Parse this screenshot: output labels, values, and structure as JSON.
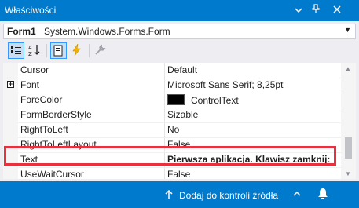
{
  "window": {
    "title": "Właściwości"
  },
  "selector": {
    "object_name": "Form1",
    "object_type": "System.Windows.Forms.Form"
  },
  "toolbar": {
    "icons": [
      "categorized-icon",
      "alphabetical-icon",
      "properties-icon",
      "events-icon",
      "wrench-icon"
    ]
  },
  "properties": [
    {
      "name": "Cursor",
      "value": "Default",
      "expandable": false
    },
    {
      "name": "Font",
      "value": "Microsoft Sans Serif; 8,25pt",
      "expandable": true,
      "expander": "+"
    },
    {
      "name": "ForeColor",
      "value": "ControlText",
      "swatch": "#000000"
    },
    {
      "name": "FormBorderStyle",
      "value": "Sizable"
    },
    {
      "name": "RightToLeft",
      "value": "No"
    },
    {
      "name": "RightToLeftLayout",
      "value": "False"
    },
    {
      "name": "Text",
      "value": "Pierwsza aplikacja. Klawisz zamknij:",
      "bold": true
    },
    {
      "name": "UseWaitCursor",
      "value": "False"
    }
  ],
  "statusbar": {
    "source_control": "Dodaj do kontroli źródła"
  },
  "colors": {
    "accent": "#007acc",
    "highlight": "#e8313f"
  }
}
